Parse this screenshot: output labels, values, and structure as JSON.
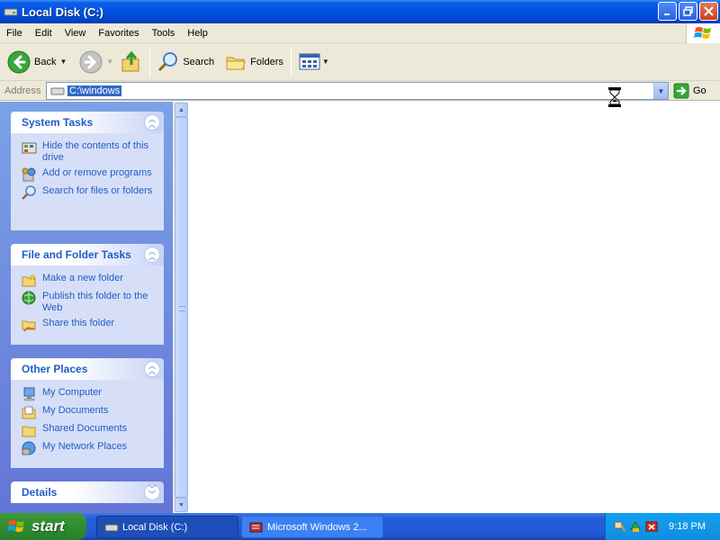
{
  "window": {
    "title": "Local Disk (C:)"
  },
  "menubar": {
    "items": [
      "File",
      "Edit",
      "View",
      "Favorites",
      "Tools",
      "Help"
    ]
  },
  "toolbar": {
    "back_label": "Back",
    "search_label": "Search",
    "folders_label": "Folders"
  },
  "address": {
    "label": "Address",
    "value": "C:\\windows",
    "go_label": "Go"
  },
  "taskpane": {
    "system_tasks": {
      "title": "System Tasks",
      "items": [
        {
          "label": "Hide the contents of this drive",
          "icon": "hide-contents-icon"
        },
        {
          "label": "Add or remove programs",
          "icon": "add-remove-programs-icon"
        },
        {
          "label": "Search for files or folders",
          "icon": "search-icon"
        }
      ]
    },
    "file_folder_tasks": {
      "title": "File and Folder Tasks",
      "items": [
        {
          "label": "Make a new folder",
          "icon": "new-folder-icon"
        },
        {
          "label": "Publish this folder to the Web",
          "icon": "publish-web-icon"
        },
        {
          "label": "Share this folder",
          "icon": "share-folder-icon"
        }
      ]
    },
    "other_places": {
      "title": "Other Places",
      "items": [
        {
          "label": "My Computer",
          "icon": "my-computer-icon"
        },
        {
          "label": "My Documents",
          "icon": "my-documents-icon"
        },
        {
          "label": "Shared Documents",
          "icon": "shared-documents-icon"
        },
        {
          "label": "My Network Places",
          "icon": "network-places-icon"
        }
      ]
    },
    "details": {
      "title": "Details"
    }
  },
  "taskbar": {
    "start_label": "start",
    "buttons": [
      {
        "label": "Local Disk (C:)",
        "active": true
      },
      {
        "label": "Microsoft Windows 2...",
        "active": false
      }
    ],
    "clock": "9:18 PM"
  },
  "colors": {
    "titlebar": "#0054e3",
    "link": "#215dc6",
    "taskpane_bg": "#7ba2e7",
    "selection": "#316ac5"
  }
}
